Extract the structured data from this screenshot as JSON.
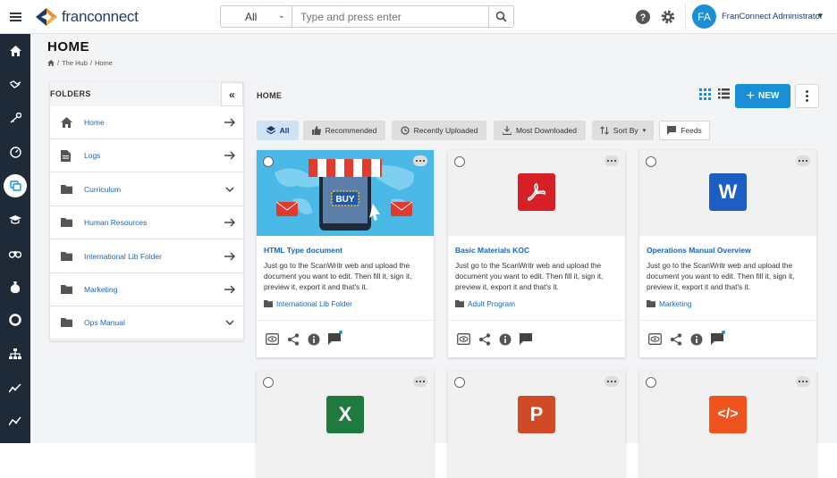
{
  "app": {
    "logo_text": "franconnect"
  },
  "search": {
    "scope": "All",
    "placeholder": "Type and press enter"
  },
  "user": {
    "initials": "FA",
    "name": "FranConnect Administrator"
  },
  "page": {
    "title": "HOME",
    "breadcrumb": [
      "The Hub",
      "Home"
    ]
  },
  "folders": {
    "title": "FOLDERS",
    "items": [
      {
        "label": "Home",
        "icon": "home-icon",
        "action": "arrow"
      },
      {
        "label": "Logs",
        "icon": "document-icon",
        "action": "arrow"
      },
      {
        "label": "Curriculum",
        "icon": "folder-icon",
        "action": "chevron"
      },
      {
        "label": "Human Resources",
        "icon": "folder-icon",
        "action": "arrow"
      },
      {
        "label": "International Lib Folder",
        "icon": "folder-icon",
        "action": "arrow"
      },
      {
        "label": "Marketing",
        "icon": "folder-icon",
        "action": "arrow"
      },
      {
        "label": "Ops Manual",
        "icon": "folder-icon",
        "action": "chevron"
      }
    ]
  },
  "content": {
    "section_title": "HOME",
    "new_label": "NEW",
    "filters": [
      {
        "label": "All",
        "active": true
      },
      {
        "label": "Recommended"
      },
      {
        "label": "Recently Uploaded"
      },
      {
        "label": "Most Downloaded"
      },
      {
        "label": "Sort By"
      },
      {
        "label": "Feeds"
      }
    ],
    "cards": [
      {
        "title": "HTML Type document",
        "description": "Just go to the ScanWritr web and upload the document you want to edit. Then fill it, sign it, preview it, export it and that's it.",
        "folder": "International Lib Folder",
        "thumb": "shop-illustration",
        "buy_label": "BUY"
      },
      {
        "title": "Basic Materials KOC",
        "description": "Just go to the ScanWritr web and upload the document you want to edit. Then fill it, sign it, preview it, export it and that's it.",
        "folder": "Adult Program",
        "thumb": "pdf-icon"
      },
      {
        "title": "Operations Manual Overview",
        "description": "Just go to the ScanWritr web and upload the document you want to edit. Then fill it, sign it, preview it, export it and that's it.",
        "folder": "Marketing",
        "thumb": "word-icon",
        "letter": "W"
      },
      {
        "thumb": "excel-icon",
        "letter": "X"
      },
      {
        "thumb": "powerpoint-icon",
        "letter": "P"
      },
      {
        "thumb": "code-icon",
        "letter": "</>"
      }
    ]
  },
  "colors": {
    "accent": "#1a8fd6",
    "rail": "#1e2a38",
    "pdf": "#d71f26",
    "word": "#1d5ec5",
    "excel": "#1f7a3e",
    "powerpoint": "#d04a26",
    "code": "#f0541e"
  }
}
